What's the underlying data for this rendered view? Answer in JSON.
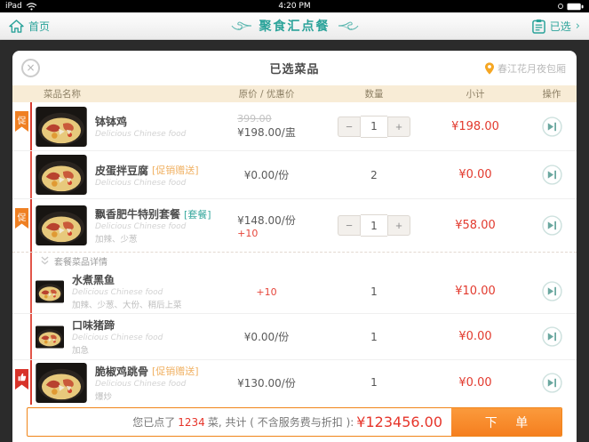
{
  "status_bar": {
    "device": "iPad",
    "time": "4:20 PM"
  },
  "nav": {
    "home": "首页",
    "title": "聚食汇点餐",
    "selected": "已选",
    "chevron": "›"
  },
  "modal": {
    "close": "×",
    "title": "已选菜品",
    "room": "春江花月夜包厢"
  },
  "table_headers": {
    "name": "菜品名称",
    "price": "原价 / 优惠价",
    "qty": "数量",
    "subtotal": "小计",
    "action": "操作"
  },
  "stepper": {
    "minus": "−",
    "plus": "+"
  },
  "set_detail_label": "套餐菜品详情",
  "rows": {
    "r1": {
      "badge": "促",
      "name": "钵钵鸡",
      "subtitle": "Delicious Chinese food",
      "orig": "399.00",
      "price": "¥198.00/盅",
      "qty": "1",
      "subtotal": "¥198.00"
    },
    "r2": {
      "name": "皮蛋拌豆腐",
      "tag": "[促销赠送]",
      "subtitle": "Delicious Chinese food",
      "price": "¥0.00/份",
      "qty": "2",
      "subtotal": "¥0.00"
    },
    "r3": {
      "badge": "促",
      "name": "飘香肥牛特别套餐",
      "tag": "[套餐]",
      "subtitle": "Delicious Chinese food",
      "note": "加辣、少葱",
      "price": "¥148.00/份",
      "extra": "+10",
      "qty": "1",
      "subtotal": "¥58.00"
    },
    "sub1": {
      "name": "水煮黑鱼",
      "subtitle": "Delicious Chinese food",
      "note": "加辣、少葱、大份、稍后上菜",
      "extra": "+10",
      "qty": "1",
      "subtotal": "¥10.00"
    },
    "sub2": {
      "name": "口味猪蹄",
      "subtitle": "Delicious Chinese food",
      "note": "加急",
      "price": "¥0.00/份",
      "qty": "1",
      "subtotal": "¥0.00"
    },
    "r4": {
      "name": "脆椒鸡跳骨",
      "tag": "[促销赠送]",
      "subtitle": "Delicious Chinese food",
      "note": "爆炒",
      "price": "¥130.00/份",
      "qty": "1",
      "subtotal": "¥0.00"
    }
  },
  "footer": {
    "before_count": "您已点了 ",
    "count": "1234",
    "after_count": " 菜, 共计 ( 不含服务费与折扣 ): ",
    "total": "¥123456.00",
    "order": "下 单"
  },
  "colors": {
    "accent_teal": "#2ba39a",
    "promo_orange": "#ef8023",
    "alert_red": "#e23a2e",
    "header_beige": "#f8ecd6"
  }
}
